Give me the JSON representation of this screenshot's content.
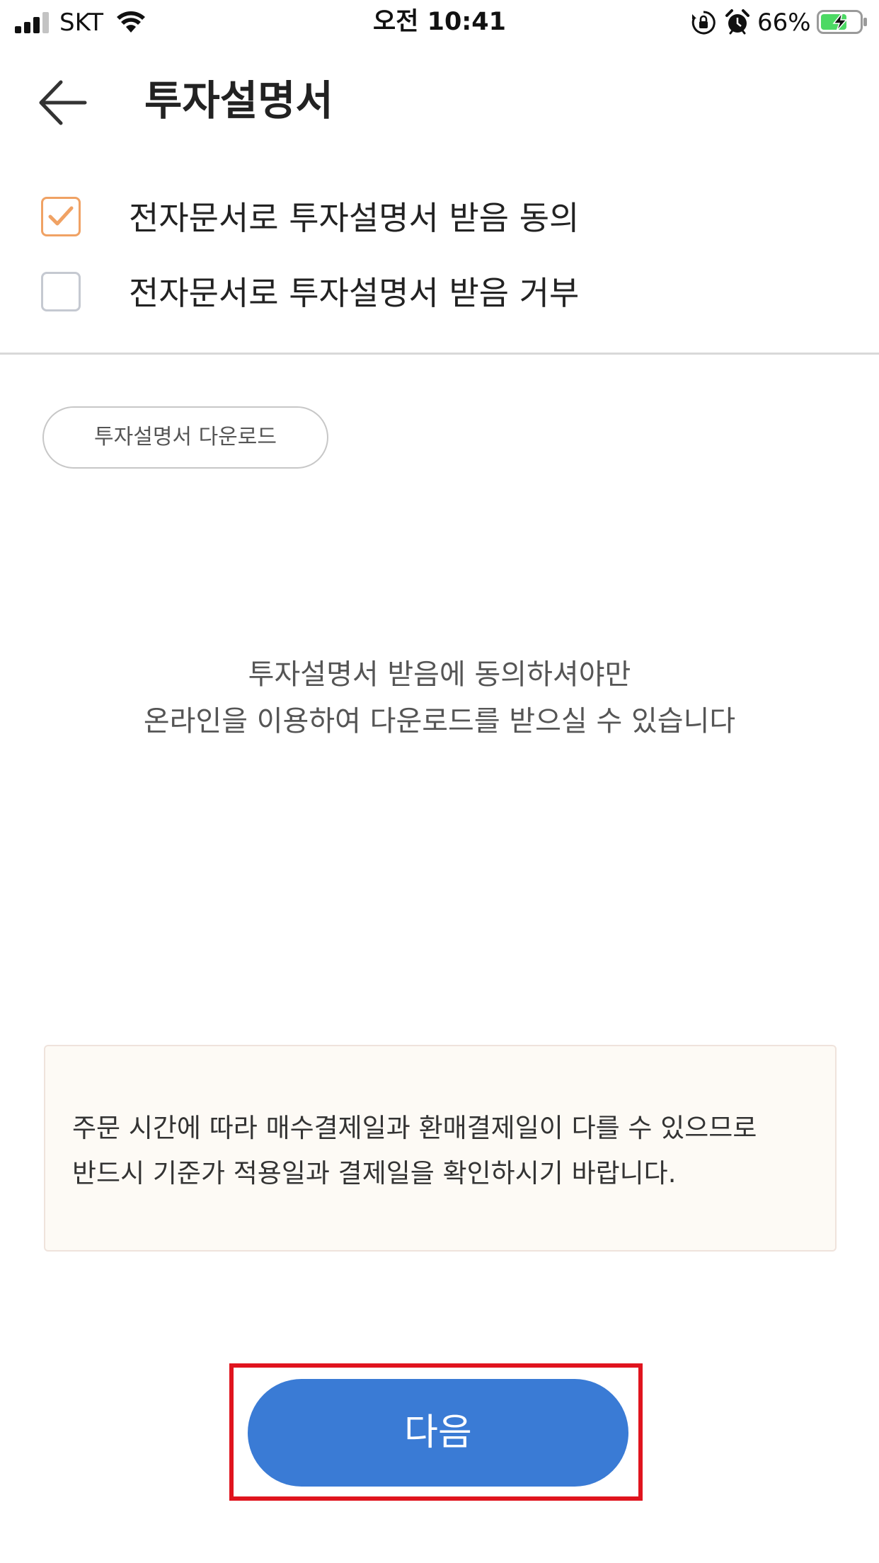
{
  "status_bar": {
    "carrier": "SKT",
    "time": "오전 10:41",
    "battery_percent": "66%",
    "signal_bars_active": 3,
    "signal_bars_total": 4,
    "battery_level": 0.66,
    "battery_charging": true,
    "icons": [
      "signal-icon",
      "wifi-icon",
      "rotation-lock-icon",
      "alarm-icon",
      "battery-icon"
    ]
  },
  "header": {
    "title": "투자설명서",
    "back_icon": "arrow-left-icon"
  },
  "options": [
    {
      "label": "전자문서로 투자설명서 받음 동의",
      "checked": true
    },
    {
      "label": "전자문서로 투자설명서 받음 거부",
      "checked": false
    }
  ],
  "download": {
    "label": "투자설명서 다운로드"
  },
  "info": {
    "line1": "투자설명서 받음에 동의하셔야만",
    "line2": "온라인을 이용하여 다운로드를 받으실 수 있습니다"
  },
  "notice": {
    "line1": "주문 시간에 따라 매수결제일과 환매결제일이 다를 수 있으므로",
    "line2": "반드시 기준가 적용일과 결제일을 확인하시기 바랍니다."
  },
  "next_button": {
    "label": "다음"
  },
  "colors": {
    "accent_blue": "#3a7bd5",
    "check_orange": "#f0a264",
    "highlight_red": "#e0141e",
    "notice_bg": "#fdfaf5",
    "battery_green": "#4cd964"
  }
}
